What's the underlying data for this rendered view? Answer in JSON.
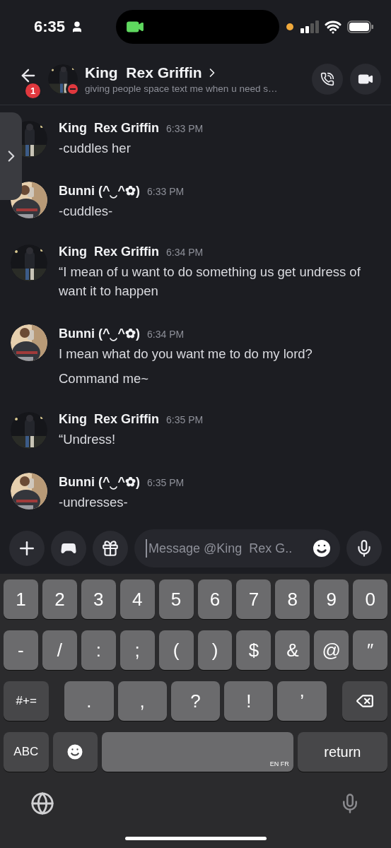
{
  "status_bar": {
    "time": "6:35"
  },
  "header": {
    "unread": "1",
    "name": "King  Rex Griffin",
    "do_not_disturb": true,
    "custom_status": "giving people space text me when u need s…"
  },
  "messages": [
    {
      "author": "King  Rex Griffin",
      "time": "6:33 PM",
      "lines": [
        "-cuddles her"
      ]
    },
    {
      "author": "Bunni (^‿^✿)",
      "time": "6:33 PM",
      "lines": [
        "-cuddles-"
      ]
    },
    {
      "author": "King  Rex Griffin",
      "time": "6:34 PM",
      "lines": [
        "“I mean of u want to do something us get undress of want it to happen"
      ]
    },
    {
      "author": "Bunni (^‿^✿)",
      "time": "6:34 PM",
      "lines": [
        "I mean what do you want me to do my lord?",
        "Command me~"
      ]
    },
    {
      "author": "King  Rex Griffin",
      "time": "6:35 PM",
      "lines": [
        "“Undress!"
      ]
    },
    {
      "author": "Bunni (^‿^✿)",
      "time": "6:35 PM",
      "lines": [
        "-undresses-"
      ]
    }
  ],
  "composer": {
    "placeholder": "Message @King  Rex G.."
  },
  "keyboard": {
    "rows": [
      {
        "keys": [
          {
            "label": "1",
            "kind": "char"
          },
          {
            "label": "2",
            "kind": "char"
          },
          {
            "label": "3",
            "kind": "char"
          },
          {
            "label": "4",
            "kind": "char"
          },
          {
            "label": "5",
            "kind": "char"
          },
          {
            "label": "6",
            "kind": "char"
          },
          {
            "label": "7",
            "kind": "char"
          },
          {
            "label": "8",
            "kind": "char"
          },
          {
            "label": "9",
            "kind": "char"
          },
          {
            "label": "0",
            "kind": "char"
          }
        ]
      },
      {
        "keys": [
          {
            "label": "-",
            "kind": "char"
          },
          {
            "label": "/",
            "kind": "char"
          },
          {
            "label": ":",
            "kind": "char"
          },
          {
            "label": ";",
            "kind": "char"
          },
          {
            "label": "(",
            "kind": "char"
          },
          {
            "label": ")",
            "kind": "char"
          },
          {
            "label": "$",
            "kind": "char"
          },
          {
            "label": "&",
            "kind": "char"
          },
          {
            "label": "@",
            "kind": "char"
          },
          {
            "label": "″",
            "kind": "char"
          }
        ]
      },
      {
        "keys": [
          {
            "label": "#+=",
            "kind": "mod"
          },
          {
            "label": ".",
            "kind": "wide"
          },
          {
            "label": ",",
            "kind": "wide"
          },
          {
            "label": "?",
            "kind": "wide"
          },
          {
            "label": "!",
            "kind": "wide"
          },
          {
            "label": "’",
            "kind": "wide"
          },
          {
            "kind": "backspace"
          }
        ]
      },
      {
        "keys": [
          {
            "label": "ABC",
            "kind": "mod"
          },
          {
            "kind": "emoji"
          },
          {
            "label": "EN FR",
            "kind": "space"
          },
          {
            "label": "return",
            "kind": "return"
          }
        ]
      }
    ]
  }
}
